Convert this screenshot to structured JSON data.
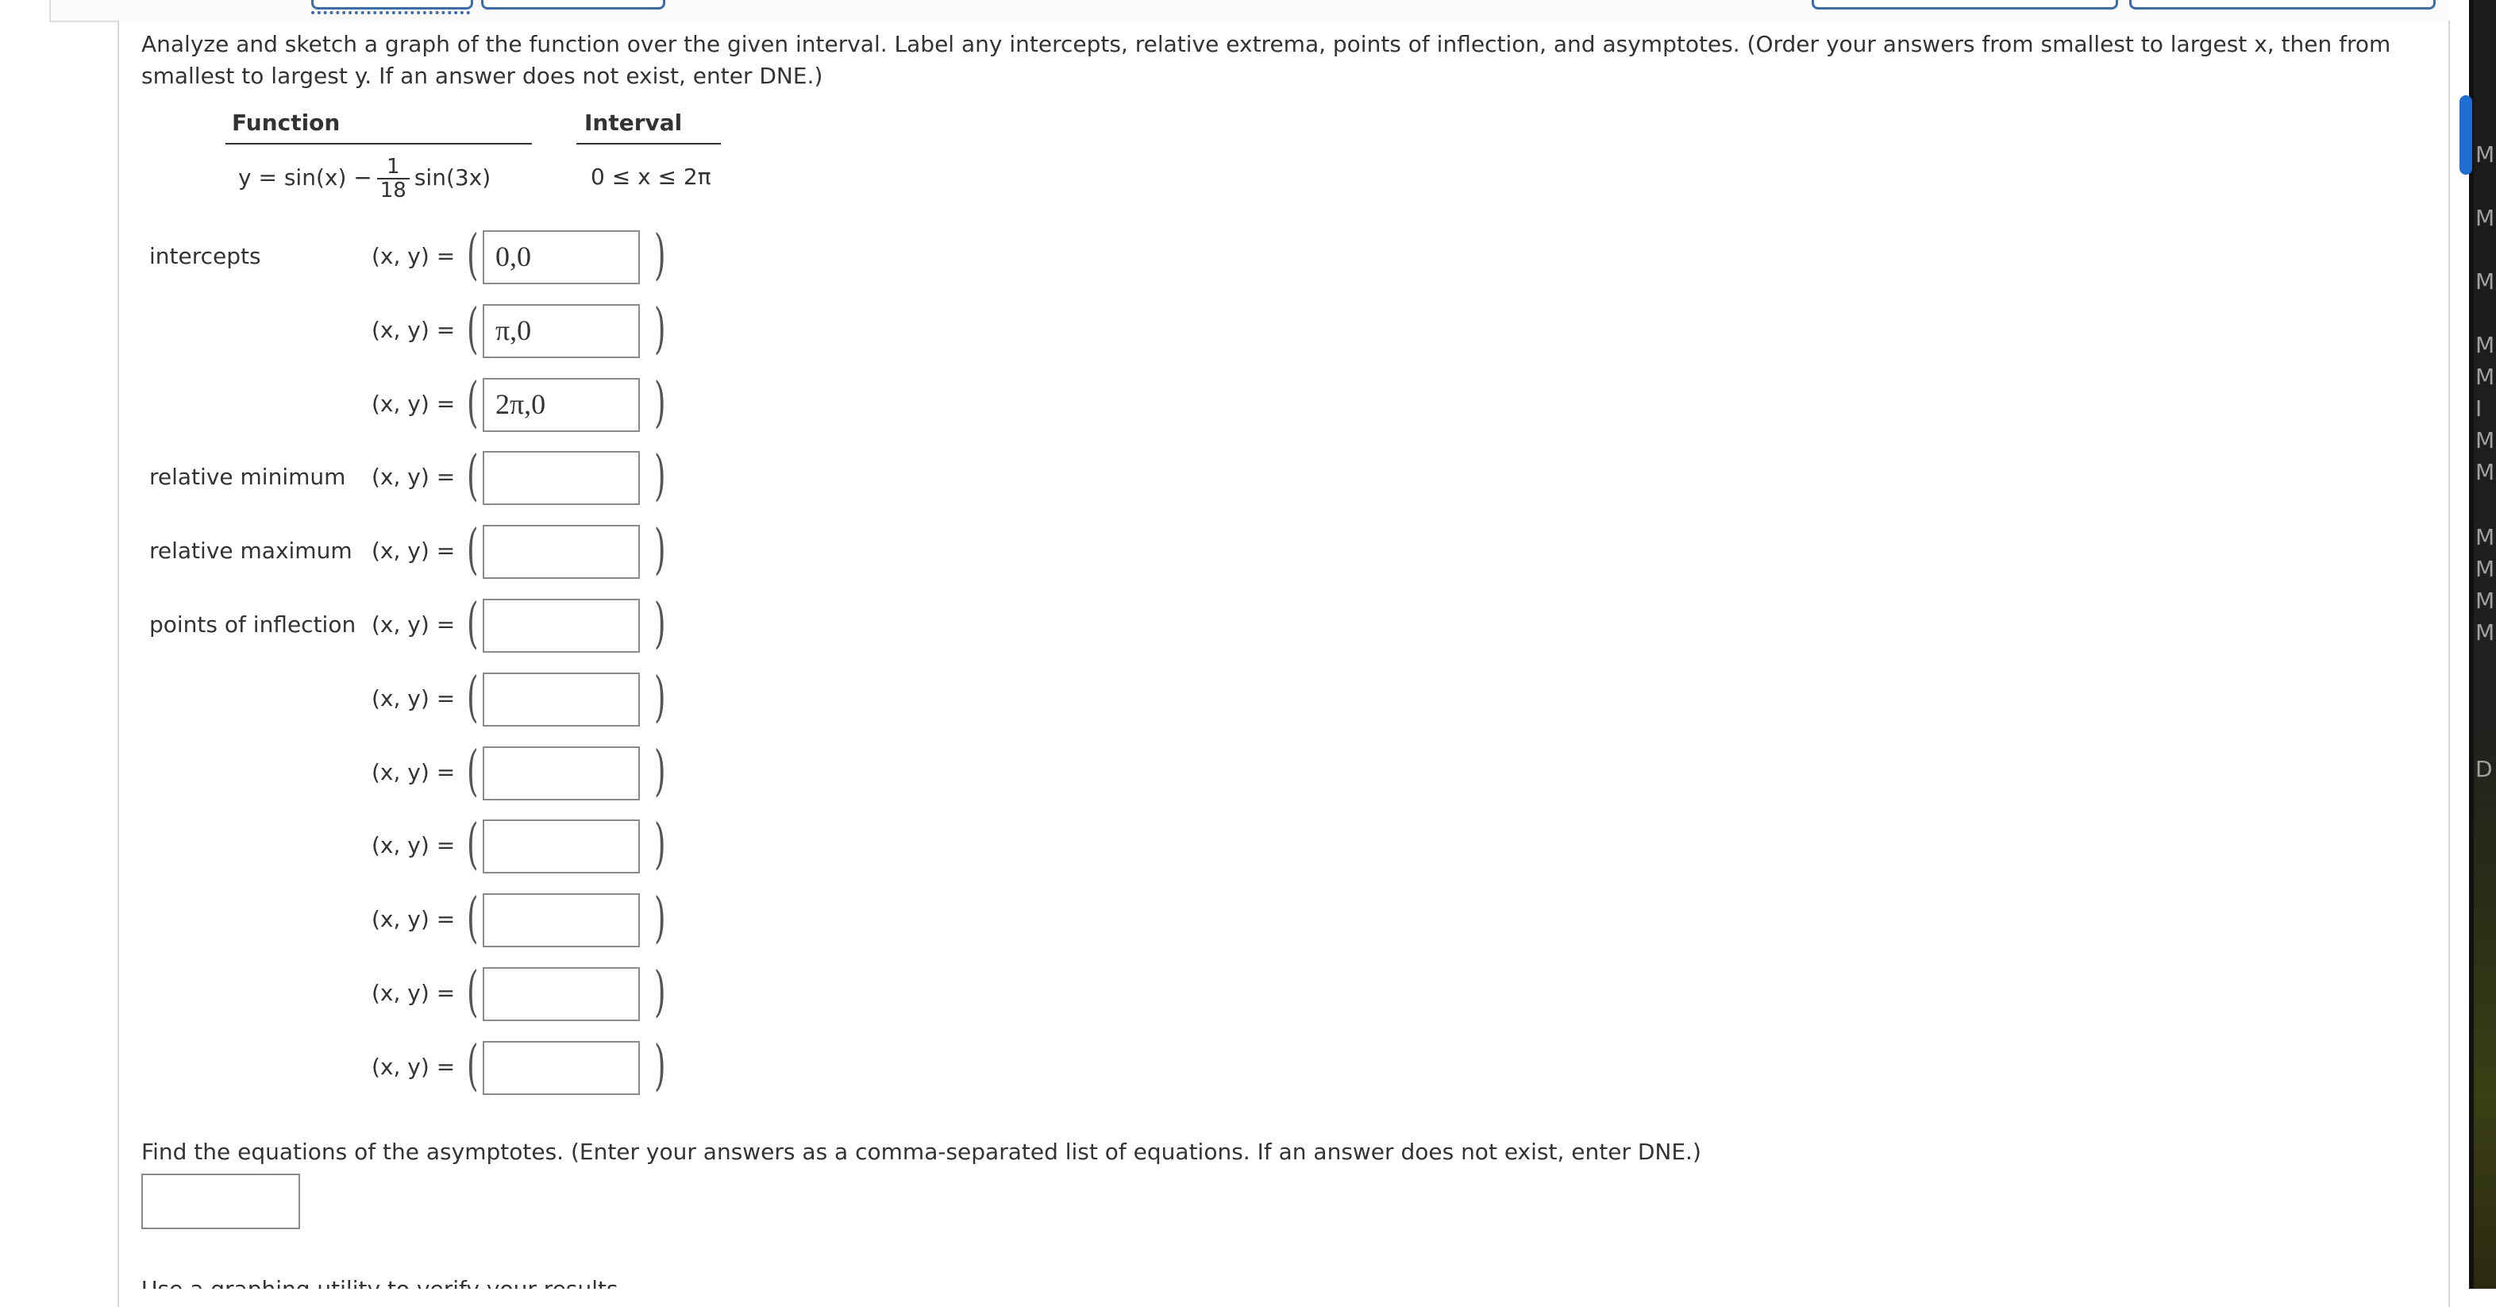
{
  "question": {
    "instructions": "Analyze and sketch a graph of the function over the given interval. Label any intercepts, relative extrema, points of inflection, and asymptotes. (Order your answers from smallest to largest x, then from smallest to largest y. If an answer does not exist, enter DNE.)",
    "function_header": "Function",
    "interval_header": "Interval",
    "function_lhs": "y = sin(x) −",
    "function_frac_num": "1",
    "function_frac_den": "18",
    "function_rhs": "sin(3x)",
    "interval_expr": "0 ≤ x ≤ 2π"
  },
  "rows": [
    {
      "label": "intercepts",
      "xy": "(x, y) =",
      "value": "0,0"
    },
    {
      "label": "",
      "xy": "(x, y) =",
      "value": "π,0"
    },
    {
      "label": "",
      "xy": "(x, y) =",
      "value": "2π,0"
    },
    {
      "label": "relative minimum",
      "xy": "(x, y) =",
      "value": ""
    },
    {
      "label": "relative maximum",
      "xy": "(x, y) =",
      "value": ""
    },
    {
      "label": "points of inflection",
      "xy": "(x, y) =",
      "value": ""
    },
    {
      "label": "",
      "xy": "(x, y) =",
      "value": ""
    },
    {
      "label": "",
      "xy": "(x, y) =",
      "value": ""
    },
    {
      "label": "",
      "xy": "(x, y) =",
      "value": ""
    },
    {
      "label": "",
      "xy": "(x, y) =",
      "value": ""
    },
    {
      "label": "",
      "xy": "(x, y) =",
      "value": ""
    },
    {
      "label": "",
      "xy": "(x, y) =",
      "value": ""
    }
  ],
  "asymptotes": {
    "prompt": "Find the equations of the asymptotes. (Enter your answers as a comma-separated list of equations. If an answer does not exist, enter DNE.)",
    "value": ""
  },
  "cutoff_text": "Use a graphing utility to verify your results.",
  "side_panel_letters": [
    "M",
    "M",
    "M",
    "M",
    "M",
    "I",
    "M",
    "M",
    "M",
    "M",
    "M",
    "M",
    "D"
  ],
  "colors": {
    "accent": "#3b6ea5",
    "scroll_accent": "#1f6fd1",
    "text": "#333333",
    "box_border": "#8a8a8a"
  }
}
